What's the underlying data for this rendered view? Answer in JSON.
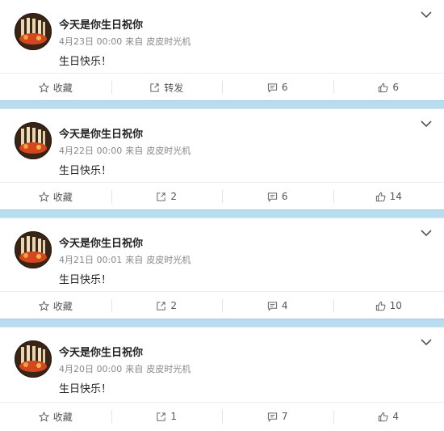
{
  "icons": {
    "collect": "star-icon",
    "repost": "share-arrow-icon",
    "comment": "comment-bubble-icon",
    "like": "thumbs-up-icon",
    "more": "chevron-down-icon",
    "avatar": "avatar-photo"
  },
  "colors": {
    "separator": "#b9dcef",
    "text": "#222222",
    "meta": "#888888"
  },
  "posts": [
    {
      "author": "今天是你生日祝你",
      "date": "4月23日 00:00",
      "from_label": "来自",
      "source": "皮皮时光机",
      "text": "生日快乐！",
      "collect_label": "收藏",
      "repost_label": "转发",
      "comments": "6",
      "likes": "6"
    },
    {
      "author": "今天是你生日祝你",
      "date": "4月22日 00:00",
      "from_label": "来自",
      "source": "皮皮时光机",
      "text": "生日快乐！",
      "collect_label": "收藏",
      "repost_label": "2",
      "comments": "6",
      "likes": "14"
    },
    {
      "author": "今天是你生日祝你",
      "date": "4月21日 00:01",
      "from_label": "来自",
      "source": "皮皮时光机",
      "text": "生日快乐！",
      "collect_label": "收藏",
      "repost_label": "2",
      "comments": "4",
      "likes": "10"
    },
    {
      "author": "今天是你生日祝你",
      "date": "4月20日 00:00",
      "from_label": "来自",
      "source": "皮皮时光机",
      "text": "生日快乐！",
      "collect_label": "收藏",
      "repost_label": "1",
      "comments": "7",
      "likes": "4"
    }
  ]
}
